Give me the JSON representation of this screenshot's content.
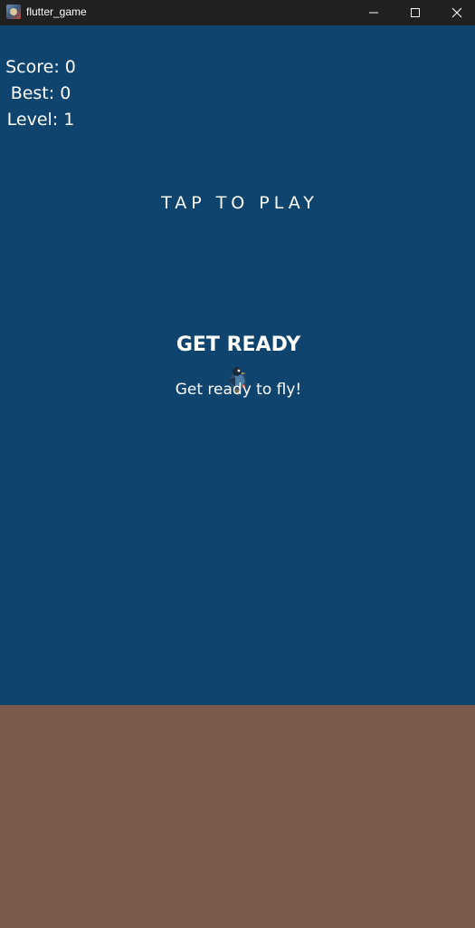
{
  "window": {
    "title": "flutter_game",
    "icons": [
      "app-icon",
      "minimize-icon",
      "maximize-icon",
      "close-icon"
    ]
  },
  "hud": {
    "score_label": "Score: 0",
    "best_label": "Best: 0",
    "level_label": "Level: 1"
  },
  "prompt": {
    "tap_to_play": "TAP TO PLAY",
    "title": "GET READY",
    "subtitle": "Get ready to fly!"
  },
  "colors": {
    "sky": "#0f446e",
    "ground": "#7b5a4b",
    "titlebar": "#202020",
    "text": "#ffffff"
  },
  "sprite": "bird-icon"
}
